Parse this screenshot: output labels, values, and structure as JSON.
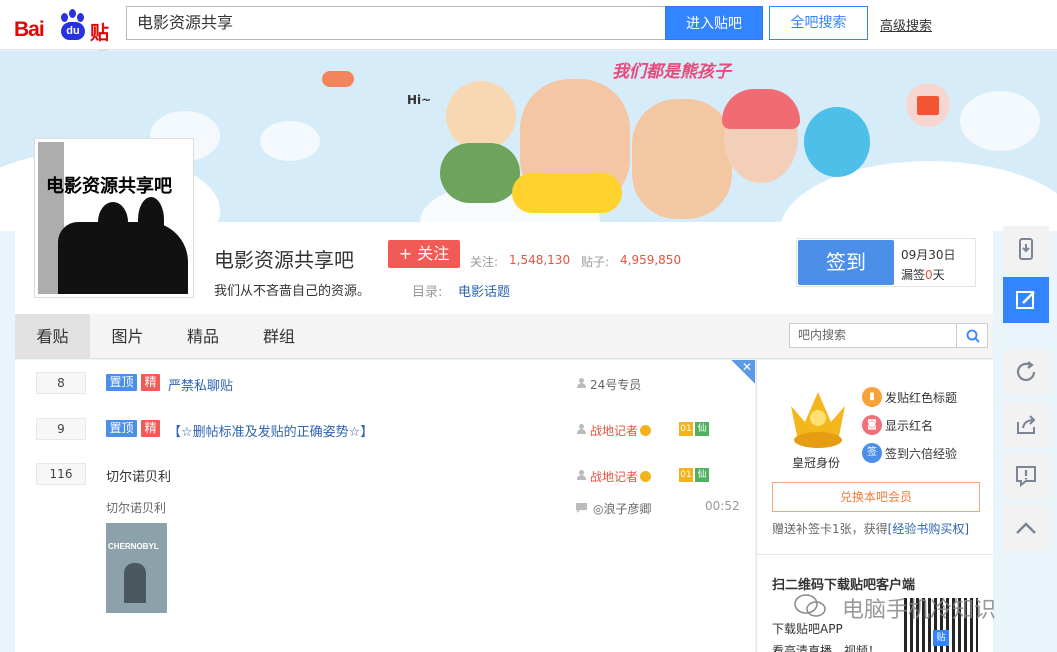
{
  "logo": {
    "bai": "Bai",
    "du": "du",
    "tieba": "贴吧"
  },
  "search": {
    "value": "电影资源共享",
    "enter_label": "进入贴吧",
    "all_label": "全吧搜索",
    "advanced_label": "高级搜索"
  },
  "banner": {
    "slogan": "我们都是熊孩子",
    "hi_text": "Hi~"
  },
  "forum": {
    "avatar_title": "电影资源共享吧",
    "name": "电影资源共享吧",
    "follow_label": "+ 关注",
    "followers_label": "关注:",
    "followers_value": "1,548,130",
    "posts_label": "贴子:",
    "posts_value": "4,959,850",
    "slogan": "我们从不吝啬自己的资源。",
    "directory_label": "目录:",
    "directory_value": "电影话题"
  },
  "sign": {
    "label": "签到",
    "date": "09月30日",
    "missed_prefix": "漏签",
    "missed_count": "0",
    "missed_suffix": "天"
  },
  "nav": {
    "tabs": [
      "看贴",
      "图片",
      "精品",
      "群组"
    ],
    "active_tab": "看贴",
    "search_placeholder": "吧内搜索"
  },
  "threads": [
    {
      "replies": "8",
      "tags": [
        "置顶",
        "精"
      ],
      "title": "严禁私聊贴",
      "author": "24号专员"
    },
    {
      "replies": "9",
      "tags": [
        "置顶",
        "精"
      ],
      "title": "【☆删帖标准及发贴的正确姿势☆】",
      "author": "战地记者"
    },
    {
      "replies": "116",
      "tags": [],
      "title": "切尔诺贝利",
      "author": "战地记者",
      "abstract": "切尔诺贝利",
      "last_reply_user": "◎浪子彦卿",
      "last_reply_time": "00:52",
      "thumb_caption": "CHERNOBYL"
    }
  ],
  "level_badges": [
    "01",
    "仙"
  ],
  "corner_close": "✕",
  "sidebar": {
    "crown_label": "皇冠身份",
    "perks": [
      "发贴红色标题",
      "显示红名",
      "签到六倍经验"
    ],
    "perk_icon_text": "签",
    "member_button": "兑换本吧会员",
    "bonus_text": "赠送补签卡1张，获得",
    "bonus_link": "[经验书购买权]",
    "qr_title": "扫二维码下载贴吧客户端",
    "qr_desc": "下载贴吧APP",
    "qr_desc2": "看高清直播、视频！",
    "qr_badge": "贴"
  },
  "watermark": "电脑手机冷知识",
  "colors": {
    "accent": "#3385ff",
    "brand_red": "#e10601",
    "follow": "#f05b56",
    "stat": "#e4533d",
    "link": "#2d64b3"
  },
  "rail_icons": [
    "download-app-icon",
    "edit-post-icon",
    "refresh-icon",
    "share-icon",
    "report-icon",
    "back-to-top-icon"
  ]
}
